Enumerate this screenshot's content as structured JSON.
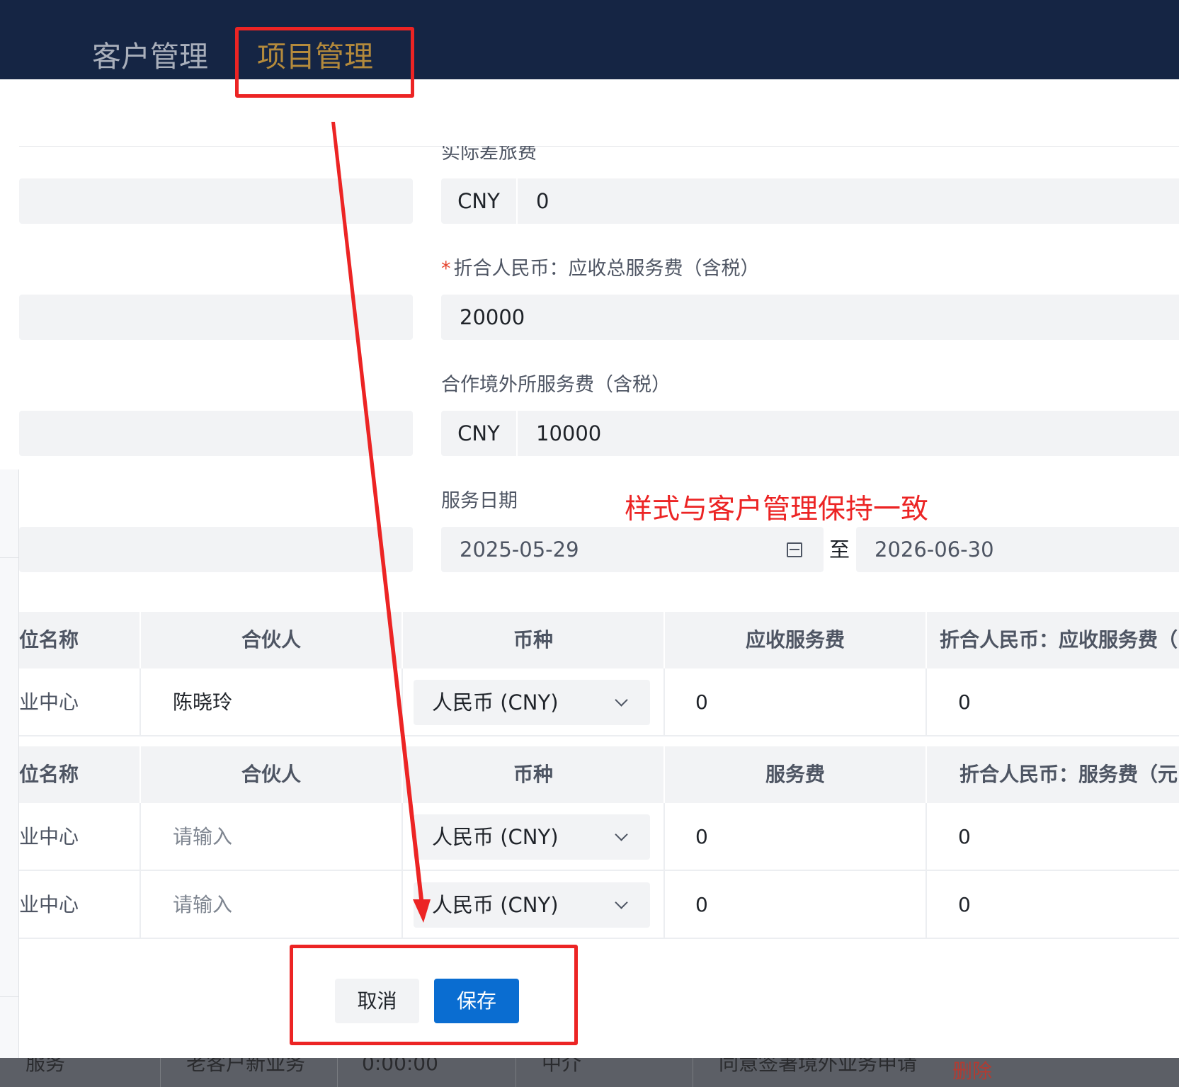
{
  "nav": {
    "tabs": [
      {
        "label": "客户管理"
      },
      {
        "label": "项目管理"
      }
    ]
  },
  "form": {
    "travel_expense": {
      "label": "实际差旅费",
      "currency": "CNY",
      "value": "0"
    },
    "total_fee_rmb": {
      "label": "折合人民币：应收总服务费（含税）",
      "required_mark": "*",
      "value": "20000"
    },
    "overseas_fee": {
      "label": "合作境外所服务费（含税）",
      "currency": "CNY",
      "value": "10000"
    },
    "service_date": {
      "label": "服务日期",
      "start": "2025-05-29",
      "separator": "至",
      "end": "2026-06-30"
    }
  },
  "table1": {
    "headers": [
      "位名称",
      "合伙人",
      "币种",
      "应收服务费",
      "折合人民币：应收服务费（"
    ],
    "rows": [
      {
        "unit": "业中心",
        "partner": "陈晓玲",
        "currency": "人民币 (CNY)",
        "fee": "0",
        "fee_rmb": "0"
      }
    ]
  },
  "table2": {
    "headers": [
      "位名称",
      "合伙人",
      "币种",
      "服务费",
      "折合人民币：服务费（元"
    ],
    "rows": [
      {
        "unit": "业中心",
        "partner_placeholder": "请输入",
        "currency": "人民币 (CNY)",
        "fee": "0",
        "fee_rmb": "0"
      },
      {
        "unit": "业中心",
        "partner_placeholder": "请输入",
        "currency": "人民币 (CNY)",
        "fee": "0",
        "fee_rmb": "0"
      }
    ]
  },
  "footer": {
    "cancel_label": "取消",
    "save_label": "保存"
  },
  "background": {
    "cells": [
      "服务",
      "老客户新业务",
      "0:00:00",
      "中介",
      "同意签署境外业务申请"
    ],
    "delete_label": "删除"
  },
  "annotation": {
    "note": "样式与客户管理保持一致",
    "color": "#ec2424"
  },
  "colors": {
    "nav_bg": "#152544",
    "active_tab": "#b48a3c",
    "primary": "#0a6dd1",
    "field_bg": "#f2f3f5"
  }
}
